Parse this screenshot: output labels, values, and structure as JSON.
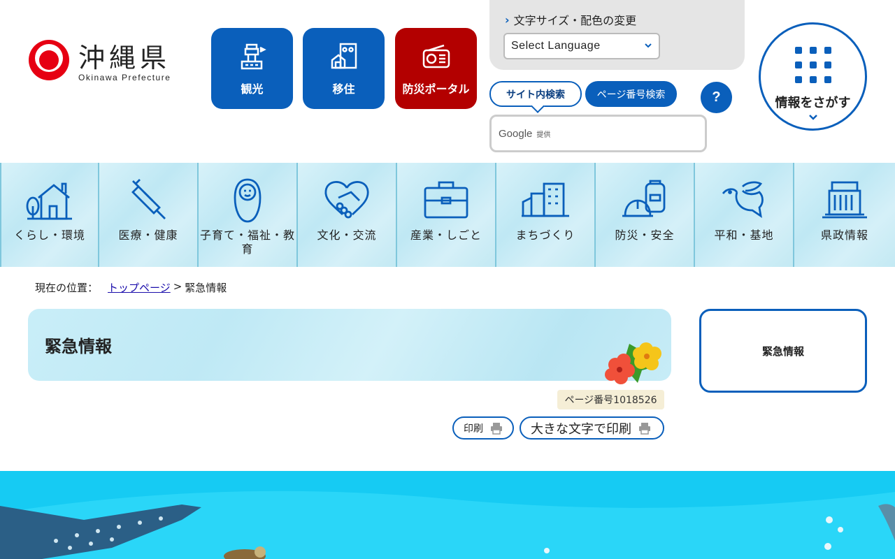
{
  "header": {
    "logo_title": "沖縄県",
    "logo_sub": "Okinawa Prefecture",
    "nav_buttons": [
      {
        "label": "観光",
        "icon": "tower-icon"
      },
      {
        "label": "移住",
        "icon": "house-building-icon"
      },
      {
        "label": "防災ポータル",
        "icon": "radio-icon"
      }
    ],
    "tools_heading": "文字サイズ・配色の変更",
    "language_select": "Select Language",
    "search_tab_site": "サイト内検索",
    "search_tab_page": "ページ番号検索",
    "help_label": "?",
    "google_label": "Google",
    "google_sub": "提供",
    "find_info": "情報をさがす"
  },
  "categories": [
    {
      "label": "くらし・環境",
      "icon": "house-tree-icon"
    },
    {
      "label": "医療・健康",
      "icon": "syringe-icon"
    },
    {
      "label": "子育て・福祉・教育",
      "icon": "baby-icon"
    },
    {
      "label": "文化・交流",
      "icon": "heart-handshake-icon"
    },
    {
      "label": "産業・しごと",
      "icon": "briefcase-icon"
    },
    {
      "label": "まちづくり",
      "icon": "city-icon"
    },
    {
      "label": "防災・安全",
      "icon": "helmet-bag-icon"
    },
    {
      "label": "平和・基地",
      "icon": "dove-icon"
    },
    {
      "label": "県政情報",
      "icon": "government-building-icon"
    }
  ],
  "breadcrumb": {
    "prefix": "現在の位置：",
    "home": "トップページ",
    "separator": ">",
    "current": "緊急情報"
  },
  "main": {
    "title": "緊急情報",
    "page_number": "ページ番号1018526",
    "print_label": "印刷",
    "print_large_label": "大きな文字で印刷"
  },
  "side": {
    "title": "緊急情報"
  },
  "colors": {
    "brand_blue": "#0a5fbb",
    "disaster_red": "#b30000",
    "ocean": "#16cbf3"
  }
}
